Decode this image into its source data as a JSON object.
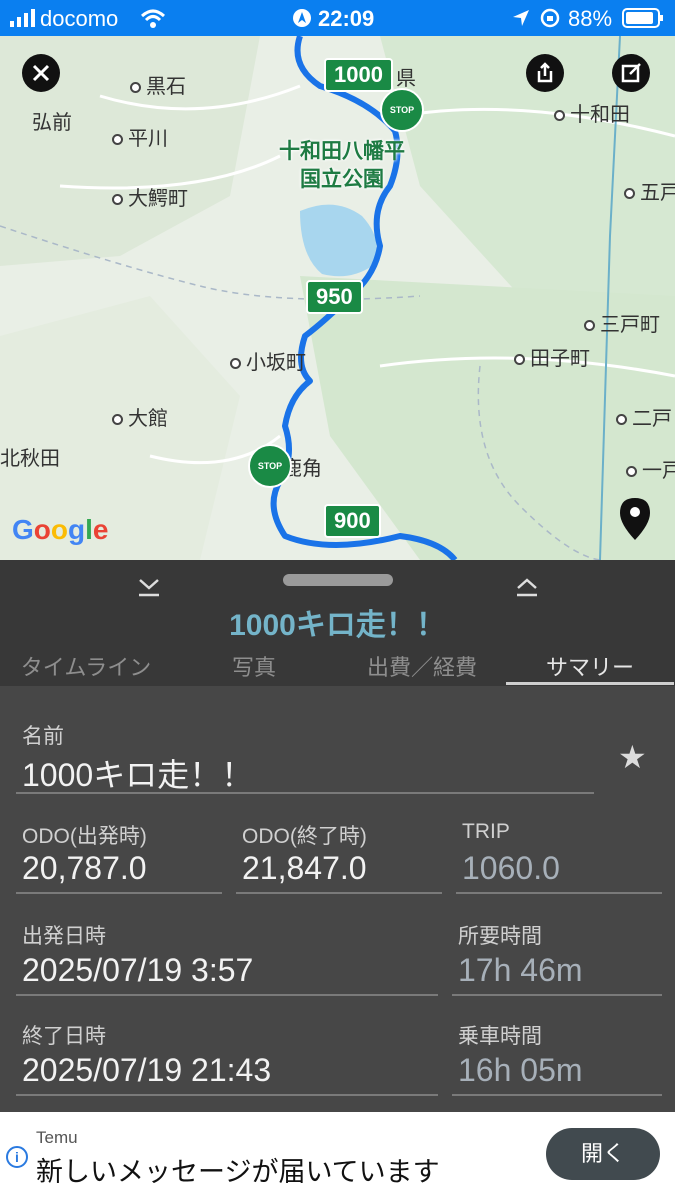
{
  "status_bar": {
    "carrier": "docomo",
    "time": "22:09",
    "battery": "88%",
    "colors": {
      "background": "#0a7ff0"
    }
  },
  "map": {
    "place_labels": [
      "黒石",
      "弘前",
      "平川",
      "大鰐町",
      "十和田",
      "五戸",
      "三戸町",
      "田子町",
      "小坂町",
      "大館",
      "二戸",
      "北秋田",
      "一戸町",
      "鹿角"
    ],
    "park_name": "十和田八幡平\n国立公園",
    "prefecture_suffix": "県",
    "km_markers": [
      "1000",
      "950",
      "900"
    ],
    "stop_label": "STOP",
    "google_logo": "Google",
    "route_color": "#1a73e8",
    "icons": [
      "close-icon",
      "share-icon",
      "edit-icon",
      "location-pin-icon"
    ]
  },
  "sheet": {
    "collapse_icon": "chevron-down-icon",
    "expand_icon": "chevron-up-icon",
    "title": "1000キロ走！！",
    "tabs": [
      {
        "label": "タイムライン",
        "active": false
      },
      {
        "label": "写真",
        "active": false
      },
      {
        "label": "出費／経費",
        "active": false
      },
      {
        "label": "サマリー",
        "active": true
      }
    ]
  },
  "summary": {
    "name_label": "名前",
    "name_value": "1000キロ走！！",
    "odo_start_label": "ODO(出発時)",
    "odo_start_value": "20,787.0",
    "odo_end_label": "ODO(終了時)",
    "odo_end_value": "21,847.0",
    "trip_label": "TRIP",
    "trip_value": "1060.0",
    "depart_label": "出発日時",
    "depart_value": "2025/07/19 3:57",
    "duration_label": "所要時間",
    "duration_value": "17h 46m",
    "end_label": "終了日時",
    "end_value": "2025/07/19 21:43",
    "ride_label": "乗車時間",
    "ride_value": "16h 05m"
  },
  "ad": {
    "brand": "Temu",
    "message": "新しいメッセージが届いています",
    "button": "開く",
    "info": "i"
  }
}
